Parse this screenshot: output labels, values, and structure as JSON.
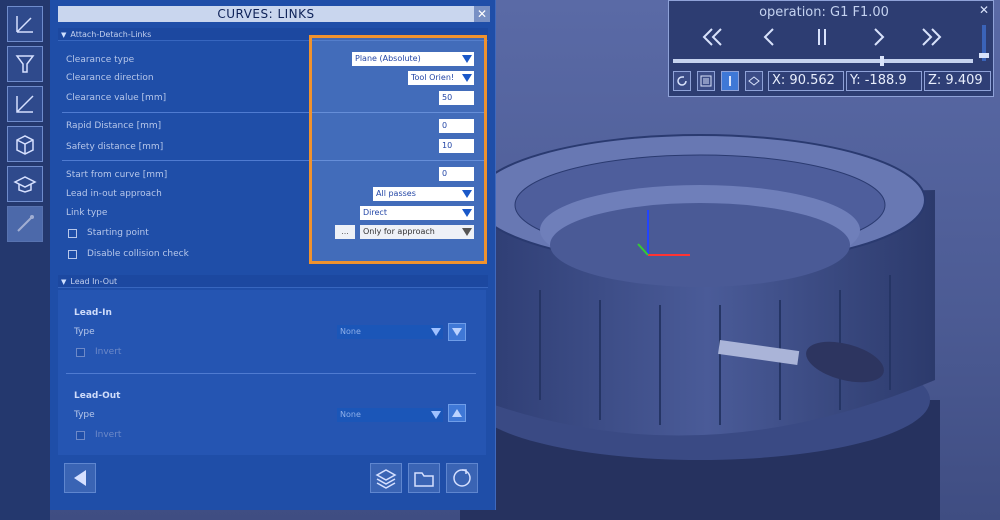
{
  "panel": {
    "title": "CURVES: LINKS",
    "close": "✕",
    "section1": "Attach-Detach-Links",
    "section2": "Lead In-Out"
  },
  "attach": {
    "clearance_type_label": "Clearance type",
    "clearance_type_value": "Plane (Absolute)",
    "clearance_dir_label": "Clearance direction",
    "clearance_dir_value": "Tool Orien!",
    "clearance_value_label": "Clearance value [mm]",
    "clearance_value": "50",
    "rapid_label": "Rapid Distance [mm]",
    "rapid_value": "0",
    "safety_label": "Safety distance [mm]",
    "safety_value": "10",
    "start_label": "Start from curve [mm]",
    "start_value": "0",
    "approach_label": "Lead in-out approach",
    "approach_value": "All passes",
    "link_label": "Link type",
    "link_value": "Direct",
    "starting_point_label": "Starting point",
    "starting_point_btn": "...",
    "starting_point_value": "Only for approach",
    "collision_label": "Disable collision check"
  },
  "leadio": {
    "lead_in_title": "Lead-In",
    "lead_in_type_label": "Type",
    "lead_in_type_value": "None",
    "lead_in_invert_label": "Invert",
    "lead_out_title": "Lead-Out",
    "lead_out_type_label": "Type",
    "lead_out_type_value": "None",
    "lead_out_invert_label": "Invert"
  },
  "playback": {
    "operation": "operation: G1 F1.00",
    "close": "✕",
    "x": "X: 90.562",
    "y": "Y: -188.9",
    "z": "Z: 9.409",
    "progress": 0.7
  },
  "icons": {
    "toolbar": [
      "axes-icon",
      "tool-icon",
      "toolpath-icon",
      "stock-icon",
      "tutorial-icon",
      "links-icon"
    ]
  }
}
